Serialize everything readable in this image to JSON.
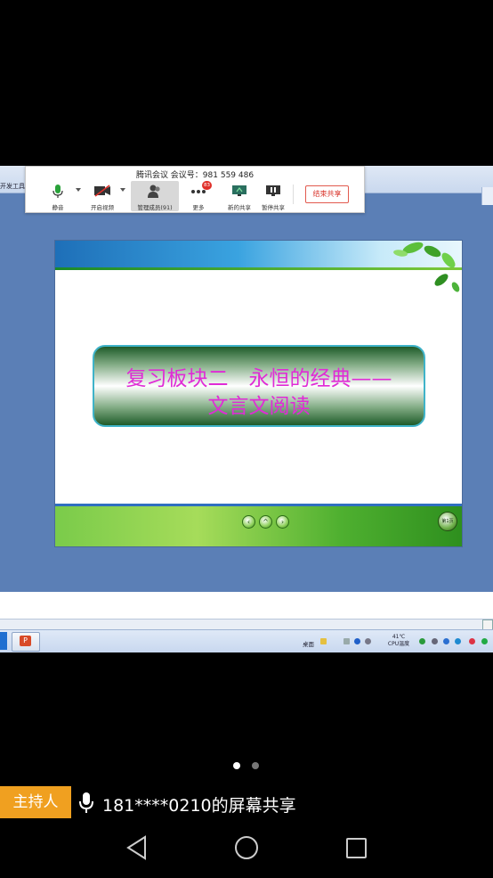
{
  "meeting": {
    "title": "腾讯会议 会议号：981 559 486",
    "buttons": {
      "mute": "静音",
      "video": "开启视频",
      "members": "管理成员(91)",
      "more": "更多",
      "more_badge": "83",
      "new_share": "新的共享",
      "pause_share": "暂停共享",
      "end_share": "结束共享"
    }
  },
  "ppt": {
    "ribbon_label": "开发工具"
  },
  "slide": {
    "title_line1": "复习板块二　永恒的经典——",
    "title_line2": "文言文阅读",
    "nav_prev": "‹",
    "nav_up": "^",
    "nav_next": "›",
    "page_label": "第1页",
    "title_color": "#e02bd6"
  },
  "taskbar": {
    "desktop_label": "桌面",
    "temp_value": "41℃",
    "temp_label": "CPU温度"
  },
  "overlay": {
    "host_badge": "主持人",
    "share_label": "181****0210的屏幕共享",
    "host_color": "#f0a020"
  },
  "icons": [
    "mic-icon",
    "camera-off-icon",
    "members-icon",
    "more-icon",
    "share-screen-icon",
    "pause-icon",
    "back-icon",
    "home-icon",
    "recent-apps-icon"
  ]
}
